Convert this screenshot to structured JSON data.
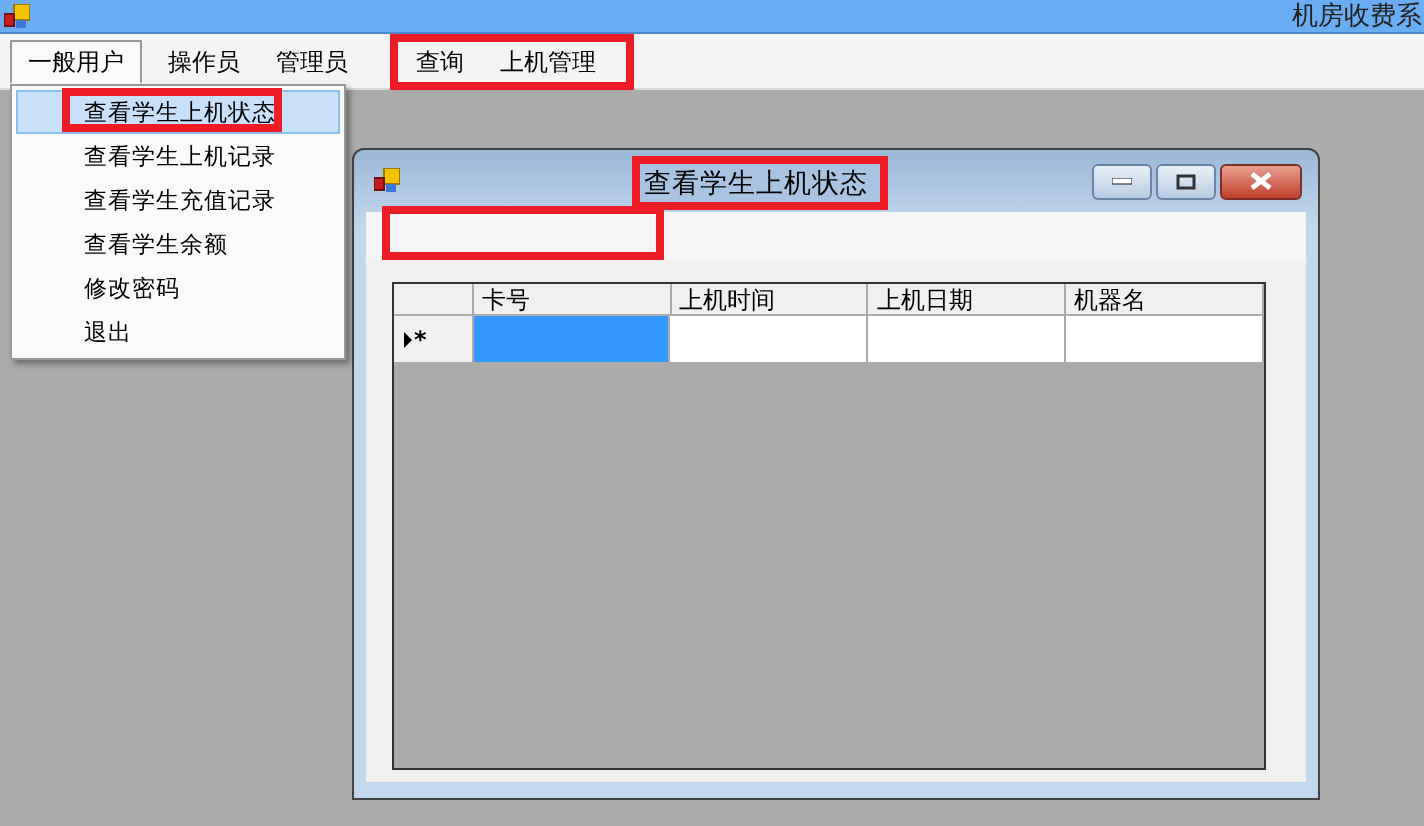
{
  "app_title": "机房收费系",
  "menu": [
    {
      "label": "一般用户",
      "selected": true
    },
    {
      "label": "操作员",
      "selected": false
    },
    {
      "label": "管理员",
      "selected": false
    },
    {
      "label": "查询",
      "selected": false
    },
    {
      "label": "上机管理",
      "selected": false
    }
  ],
  "dropdown": [
    {
      "label": "查看学生上机状态",
      "selected": true
    },
    {
      "label": "查看学生上机记录",
      "selected": false
    },
    {
      "label": "查看学生充值记录",
      "selected": false
    },
    {
      "label": "查看学生余额",
      "selected": false
    },
    {
      "label": "修改密码",
      "selected": false
    },
    {
      "label": "退出",
      "selected": false
    }
  ],
  "child_window": {
    "title": "查看学生上机状态"
  },
  "grid": {
    "columns": [
      "卡号",
      "上机时间",
      "上机日期",
      "机器名"
    ],
    "new_row": {
      "marker": "*",
      "cells": [
        {
          "selected": true
        },
        {
          "selected": false
        },
        {
          "selected": false
        },
        {
          "selected": false
        }
      ]
    }
  }
}
